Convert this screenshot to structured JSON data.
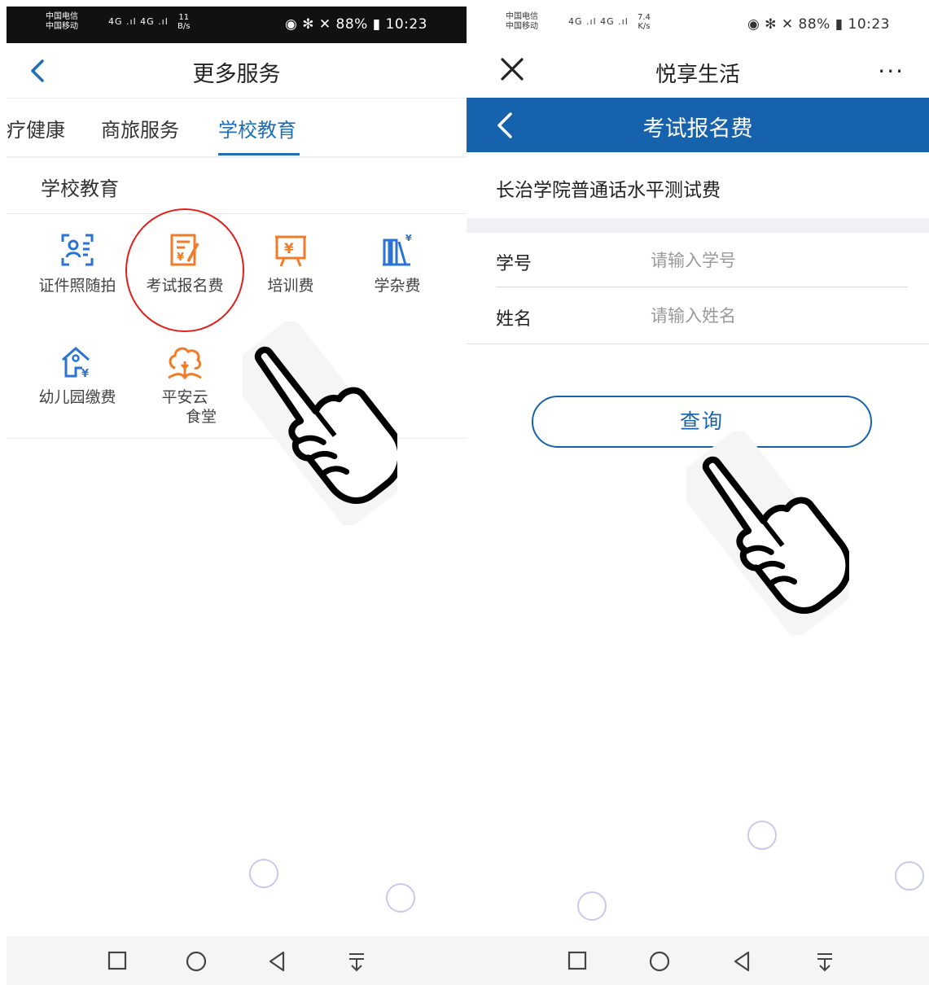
{
  "left": {
    "status": {
      "carrier1": "中国电信",
      "carrier2": "中国移动",
      "net": "4G .ıl 4G .ıl",
      "speed_value": "11",
      "speed_unit": "B/s",
      "battery": "88%",
      "time": "10:23"
    },
    "header": {
      "title": "更多服务"
    },
    "tabs": [
      {
        "label": "疗健康"
      },
      {
        "label": "商旅服务"
      },
      {
        "label": "学校教育",
        "active": true
      }
    ],
    "section_title": "学校教育",
    "services": [
      {
        "label": "证件照随拍",
        "icon": "id-photo-icon"
      },
      {
        "label": "考试报名费",
        "icon": "exam-fee-icon"
      },
      {
        "label": "培训费",
        "icon": "training-fee-icon"
      },
      {
        "label": "学杂费",
        "icon": "tuition-fee-icon"
      },
      {
        "label": "幼儿园缴费",
        "icon": "kindergarten-icon"
      },
      {
        "label_line1": "平安云",
        "label_line2": "食堂",
        "icon": "canteen-icon"
      }
    ]
  },
  "right": {
    "status": {
      "carrier1": "中国电信",
      "carrier2": "中国移动",
      "net": "4G .ıl 4G .ıl",
      "speed_value": "7.4",
      "speed_unit": "K/s",
      "battery": "88%",
      "time": "10:23"
    },
    "header": {
      "title": "悦享生活",
      "more": "···"
    },
    "page": {
      "title": "考试报名费",
      "fee_name": "长治学院普通话水平测试费",
      "fields": [
        {
          "label": "学号",
          "placeholder": "请输入学号"
        },
        {
          "label": "姓名",
          "placeholder": "请输入姓名"
        }
      ],
      "query_button": "查询"
    }
  },
  "colors": {
    "accent_blue": "#1662ad",
    "tab_active": "#1f6fb5",
    "icon_blue": "#2a72d6",
    "icon_orange": "#f07b2a",
    "highlight_red": "#e0201c"
  }
}
